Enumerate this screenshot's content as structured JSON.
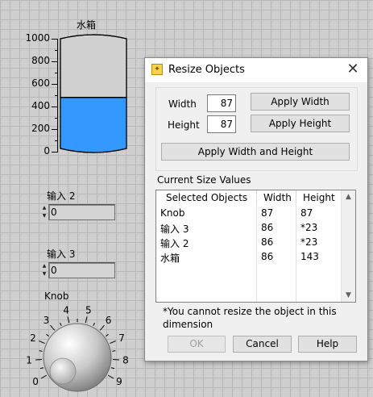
{
  "tank": {
    "label": "水箱",
    "scale": [
      "1000",
      "800",
      "600",
      "400",
      "200",
      "0"
    ],
    "level": 480,
    "max": 1000,
    "fill_color": "#3399ff"
  },
  "controls": [
    {
      "label": "输入 2",
      "value": "0"
    },
    {
      "label": "输入 3",
      "value": "0"
    }
  ],
  "knob": {
    "label": "Knob",
    "scale": [
      "0",
      "1",
      "2",
      "3",
      "4",
      "5",
      "6",
      "7",
      "8",
      "9"
    ]
  },
  "dialog": {
    "title": "Resize Objects",
    "width_label": "Width",
    "width_value": "87",
    "height_label": "Height",
    "height_value": "87",
    "apply_width": "Apply Width",
    "apply_height": "Apply Height",
    "apply_both": "Apply Width and Height",
    "current_label": "Current Size Values",
    "columns": [
      "Selected Objects",
      "Width",
      "Height"
    ],
    "rows": [
      [
        "Knob",
        "87",
        "87"
      ],
      [
        "输入 3",
        "86",
        "*23"
      ],
      [
        "输入 2",
        "86",
        "*23"
      ],
      [
        "水箱",
        "86",
        "143"
      ]
    ],
    "footnote": "*You cannot resize the object in this dimension",
    "ok": "OK",
    "cancel": "Cancel",
    "help": "Help"
  }
}
